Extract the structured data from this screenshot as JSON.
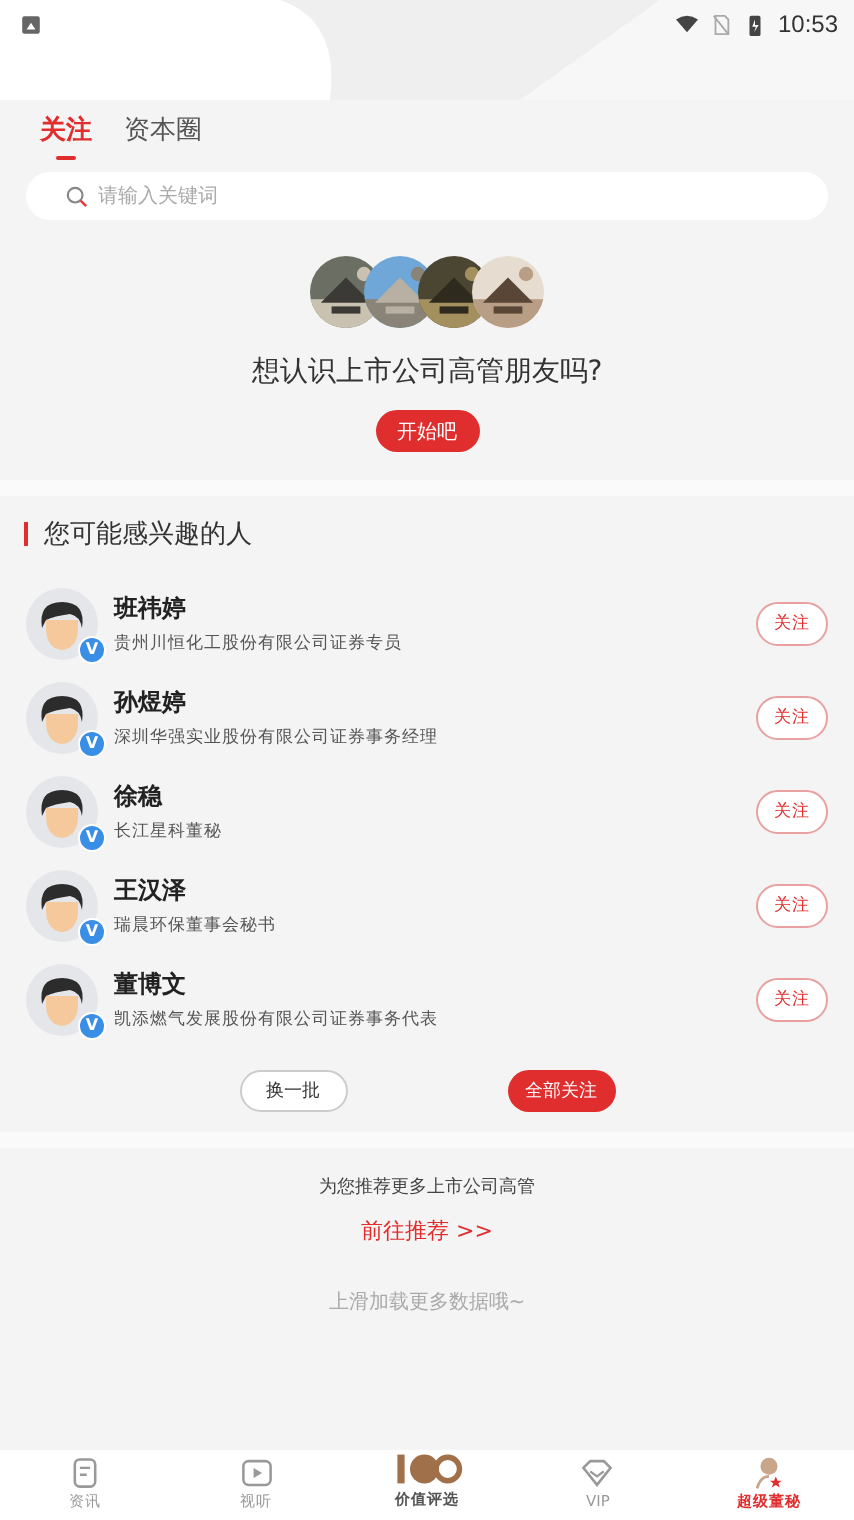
{
  "status_bar": {
    "time": "10:53"
  },
  "tabs": [
    {
      "label": "关注",
      "selected": true
    },
    {
      "label": "资本圈",
      "selected": false
    }
  ],
  "search": {
    "placeholder": "请输入关键词"
  },
  "invite": {
    "question": "想认识上市公司高管朋友吗?",
    "button": "开始吧"
  },
  "suggestions": {
    "title": "您可能感兴趣的人",
    "people": [
      {
        "name": "班祎婷",
        "title": "贵州川恒化工股份有限公司证券专员",
        "badge": "V",
        "follow": "关注"
      },
      {
        "name": "孙煜婷",
        "title": "深圳华强实业股份有限公司证券事务经理",
        "badge": "V",
        "follow": "关注"
      },
      {
        "name": "徐稳",
        "title": "长江星科董秘",
        "badge": "V",
        "follow": "关注"
      },
      {
        "name": "王汉泽",
        "title": "瑞晨环保董事会秘书",
        "badge": "V",
        "follow": "关注"
      },
      {
        "name": "董博文",
        "title": "凯添燃气发展股份有限公司证券事务代表",
        "badge": "V",
        "follow": "关注"
      }
    ],
    "refresh": "换一批",
    "follow_all": "全部关注"
  },
  "recommend": {
    "text": "为您推荐更多上市公司高管",
    "link": "前往推荐 >>"
  },
  "load_more": "上滑加载更多数据哦~",
  "nav": [
    {
      "label": "资讯",
      "kind": "news",
      "selected": false
    },
    {
      "label": "视听",
      "kind": "video",
      "selected": false
    },
    {
      "label": "价值评选",
      "kind": "logo",
      "selected": false
    },
    {
      "label": "VIP",
      "kind": "vip",
      "selected": false
    },
    {
      "label": "超级董秘",
      "kind": "person",
      "selected": true
    }
  ]
}
